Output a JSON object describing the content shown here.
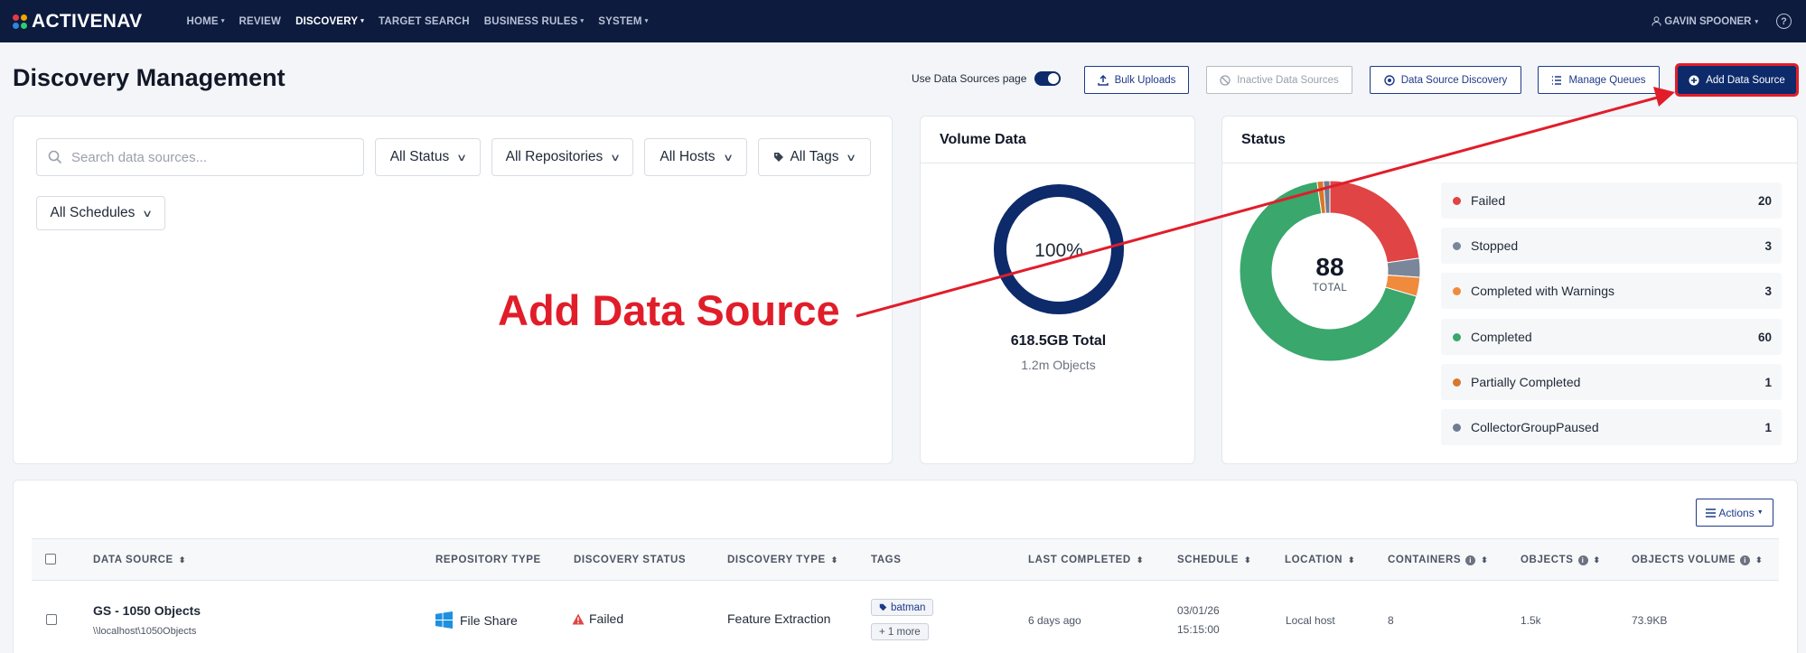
{
  "nav": {
    "brand": "ACTIVENAV",
    "brand_dots": [
      "#e63946",
      "#f4a300",
      "#2e86de",
      "#2ecc71"
    ],
    "items": [
      {
        "label": "HOME",
        "caret": "▾"
      },
      {
        "label": "REVIEW",
        "caret": ""
      },
      {
        "label": "DISCOVERY",
        "caret": "▾"
      },
      {
        "label": "TARGET SEARCH",
        "caret": ""
      },
      {
        "label": "BUSINESS RULES",
        "caret": "▾"
      },
      {
        "label": "SYSTEM",
        "caret": "▾"
      }
    ],
    "active": "DISCOVERY",
    "user": "GAVIN SPOONER",
    "user_caret": "▾",
    "help": "?"
  },
  "header": {
    "title": "Discovery Management",
    "toggle_label": "Use Data Sources page",
    "toggle_on": true,
    "buttons": {
      "bulk_uploads": "Bulk Uploads",
      "inactive": "Inactive Data Sources",
      "discovery": "Data Source Discovery",
      "queues": "Manage Queues",
      "add": "Add Data Source"
    }
  },
  "filters": {
    "search_placeholder": "Search data sources...",
    "status": "All Status",
    "repositories": "All Repositories",
    "hosts": "All Hosts",
    "tags": "All Tags",
    "schedules": "All Schedules"
  },
  "volume": {
    "title": "Volume Data",
    "percent": "100%",
    "total": "618.5GB Total",
    "objects": "1.2m Objects",
    "fill_fraction": 1.0,
    "color": "#0d2a6b"
  },
  "status": {
    "title": "Status",
    "total": "88",
    "total_label": "TOTAL",
    "items": [
      {
        "label": "Failed",
        "count": "20",
        "value": 20,
        "color": "#e04444"
      },
      {
        "label": "Stopped",
        "count": "3",
        "value": 3,
        "color": "#7a8699"
      },
      {
        "label": "Completed with Warnings",
        "count": "3",
        "value": 3,
        "color": "#f08a3c"
      },
      {
        "label": "Completed",
        "count": "60",
        "value": 60,
        "color": "#3aa76d"
      },
      {
        "label": "Partially Completed",
        "count": "1",
        "value": 1,
        "color": "#d9772b"
      },
      {
        "label": "CollectorGroupPaused",
        "count": "1",
        "value": 1,
        "color": "#6f7c93"
      }
    ]
  },
  "table": {
    "actions_label": "Actions",
    "columns": {
      "data_source": "DATA SOURCE",
      "repository_type": "REPOSITORY TYPE",
      "discovery_status": "DISCOVERY STATUS",
      "discovery_type": "DISCOVERY TYPE",
      "tags": "TAGS",
      "last_completed": "LAST COMPLETED",
      "schedule": "SCHEDULE",
      "location": "LOCATION",
      "containers": "CONTAINERS",
      "objects": "OBJECTS",
      "objects_volume": "OBJECTS VOLUME"
    },
    "rows": [
      {
        "name": "GS - 1050 Objects",
        "path": "\\\\localhost\\1050Objects",
        "repository_type": "File Share",
        "discovery_status": "Failed",
        "discovery_type": "Feature Extraction",
        "tag": "batman",
        "more_tags": "+ 1 more",
        "last_completed": "6 days ago",
        "schedule_date": "03/01/26",
        "schedule_time": "15:15:00",
        "location": "Local host",
        "containers": "8",
        "objects": "1.5k",
        "objects_volume": "73.9KB"
      }
    ]
  },
  "annotation": {
    "text": "Add Data Source",
    "color": "#e11d2a"
  }
}
